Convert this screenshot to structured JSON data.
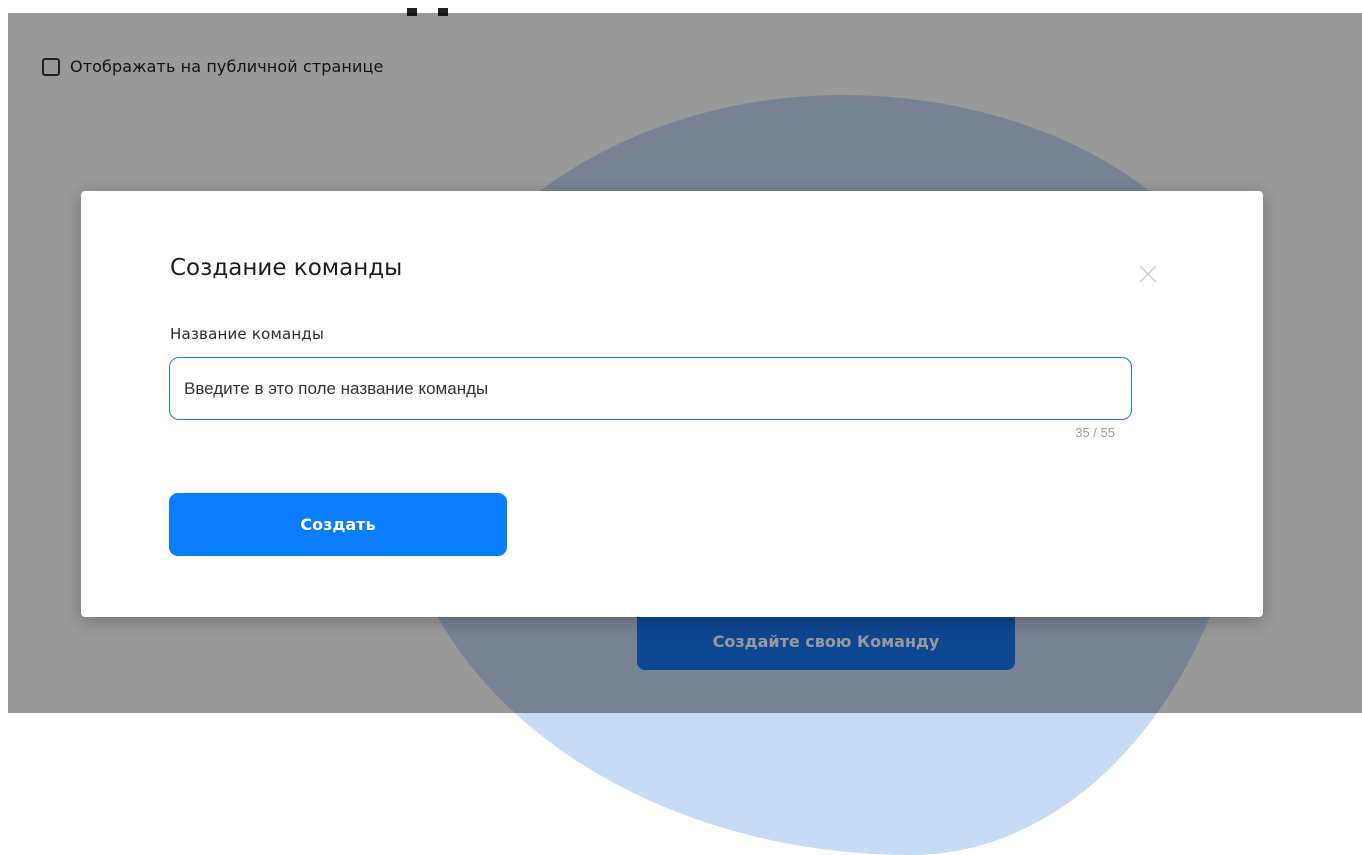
{
  "background": {
    "checkbox_label": "Отображать на публичной странице",
    "create_team_button": "Создайте свою Команду"
  },
  "modal": {
    "title": "Создание команды",
    "field_label": "Название команды",
    "input_value": "Введите в это поле название команды",
    "char_counter": "35 / 55",
    "submit_label": "Создать",
    "close_icon": "close-icon"
  },
  "colors": {
    "primary": "#0a7cff",
    "input_border": "#1a7cf0",
    "overlay": "rgba(0,0,0,0.40)",
    "blob": "#c6dbf5"
  }
}
